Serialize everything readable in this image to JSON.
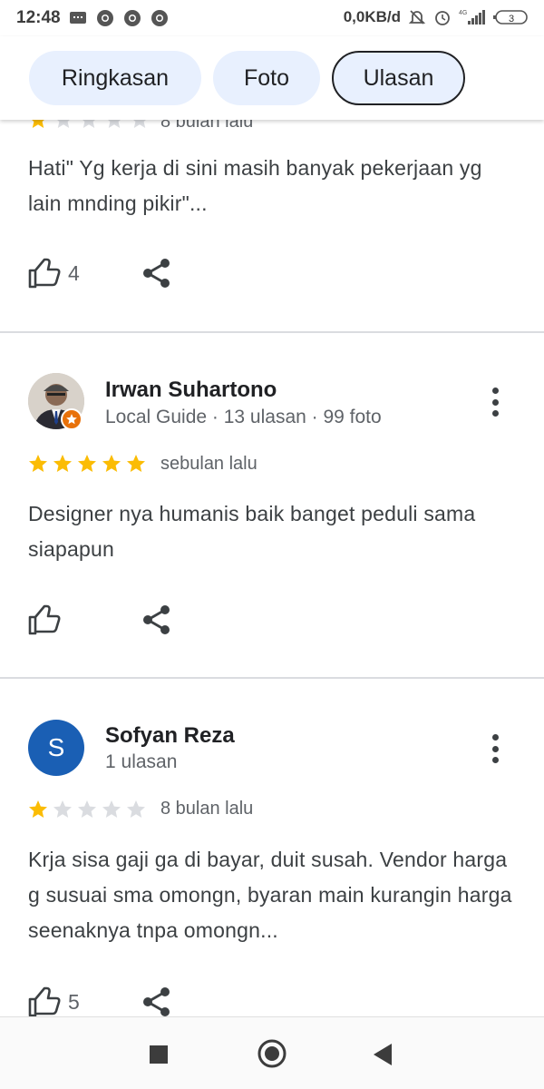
{
  "status_bar": {
    "time": "12:48",
    "net_speed": "0,0KB/d",
    "network": "4G",
    "battery": "3"
  },
  "tabs": [
    {
      "label": "Ringkasan",
      "selected": false
    },
    {
      "label": "Foto",
      "selected": false
    },
    {
      "label": "Ulasan",
      "selected": true
    }
  ],
  "reviews": [
    {
      "partial": true,
      "rating": 1,
      "time": "8 bulan lalu",
      "text": "Hati\" Yg kerja di sini masih banyak pekerjaan yg lain mnding pikir\"...",
      "likes": "4"
    },
    {
      "name": "Irwan Suhartono",
      "meta": "Local Guide · 13 ulasan · 99 foto",
      "rating": 5,
      "time": "sebulan lalu",
      "text": "Designer nya humanis baik banget peduli sama siapapun",
      "likes": ""
    },
    {
      "name": "Sofyan Reza",
      "avatar_letter": "S",
      "meta": "1 ulasan",
      "rating": 1,
      "time": "8 bulan lalu",
      "text": "Krja sisa gaji ga di bayar, duit susah. Vendor harga g susuai sma omongn, byaran main kurangin harga seenaknya tnpa omongn...",
      "likes": "5"
    }
  ],
  "colors": {
    "star_filled": "#fbbc04",
    "star_empty": "#dadce0",
    "tab_bg": "#e8f0fe",
    "avatar_bg": "#1a5fb4",
    "guide_badge": "#e8710a"
  },
  "icons": {
    "like": "thumbs-up-icon",
    "share": "share-icon",
    "more": "more-vert-icon"
  }
}
